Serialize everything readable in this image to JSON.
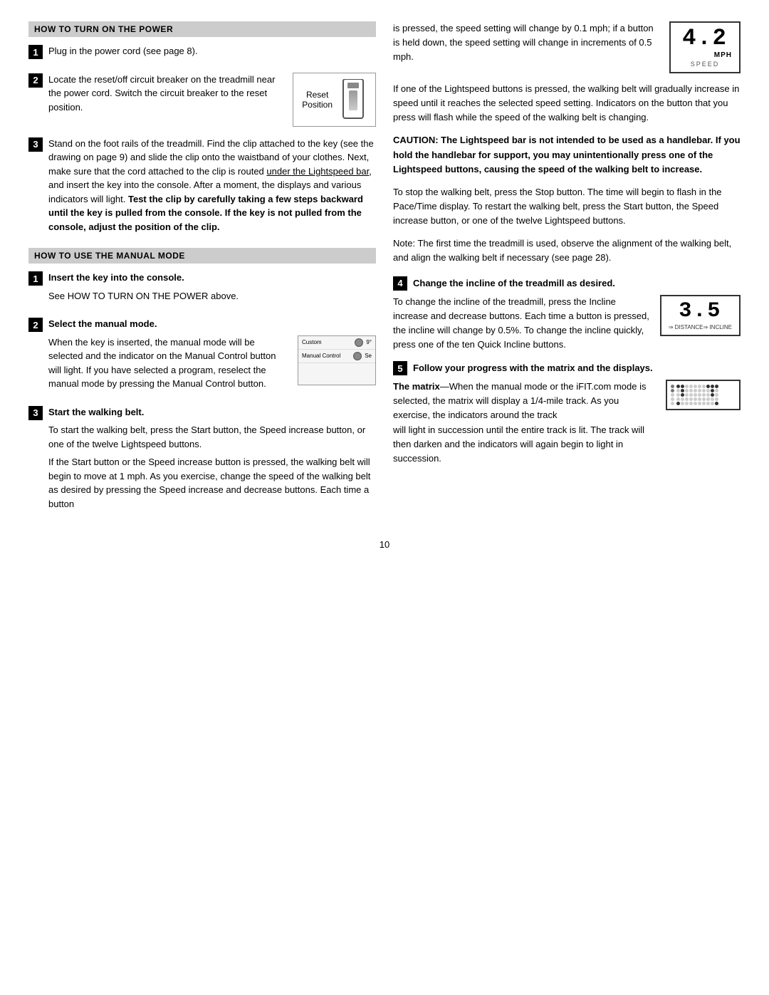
{
  "left_col": {
    "section1": {
      "header": "HOW TO TURN ON THE POWER",
      "step1": {
        "number": "1",
        "text": "Plug in the power cord (see page 8)."
      },
      "step2": {
        "number": "2",
        "text_before": "Locate the reset/off circuit breaker on the treadmill near the power cord. Switch the circuit breaker to the reset position.",
        "reset_label_line1": "Reset",
        "reset_label_line2": "Position"
      },
      "step3": {
        "number": "3",
        "text": "Stand on the foot rails of the treadmill. Find the clip attached to the key (see the drawing on page 9) and slide the clip onto the waistband of your clothes. Next, make sure that the cord attached to the clip is routed ",
        "underline": "under the Lightspeed bar,",
        "text2": " and insert the key into the console. After a moment, the displays and various indicators will light. ",
        "bold_part": "Test the clip by carefully taking a few steps backward until the key is pulled from the console. If the key is not pulled from the console, adjust the position of the clip."
      }
    },
    "section2": {
      "header": "HOW TO USE THE MANUAL MODE",
      "step1": {
        "number": "1",
        "title": "Insert the key into the console.",
        "text": "See HOW TO TURN ON THE POWER above."
      },
      "step2": {
        "number": "2",
        "title": "Select the manual mode.",
        "text1": "When the key is inserted, the manual mode will be selected and the indicator on the Manual Control button will light. If you have selected a program, reselect the manual mode by pressing the Manual Control button.",
        "btn1": "Custom",
        "btn2": "Manual Control"
      },
      "step3": {
        "number": "3",
        "title": "Start the walking belt.",
        "text1": "To start the walking belt, press the Start button, the Speed increase button, or one of the twelve Lightspeed buttons.",
        "text2": "If the Start button or the Speed increase button is pressed, the walking belt will begin to move at 1 mph. As you exercise, change the speed of the walking belt as desired by pressing the Speed increase and decrease buttons. Each time a button"
      }
    }
  },
  "right_col": {
    "speed_display": {
      "number": "4.2",
      "unit": "MPH",
      "label": "SPEED"
    },
    "para1": "is pressed, the speed setting will change by 0.1 mph; if a button is held down, the speed setting will change in increments of 0.5 mph.",
    "para2": "If one of the Lightspeed buttons is pressed, the walking belt will gradually increase in speed until it reaches the selected speed setting. Indicators on the button that you press will flash while the speed of the walking belt is changing.",
    "caution": {
      "text": "CAUTION: The Lightspeed bar is not intended to be used as a handlebar. If you hold the handlebar for support, you may unintentionally press one of the Lightspeed buttons, causing the speed of the walking belt to increase."
    },
    "para3": "To stop the walking belt, press the Stop button. The time will begin to flash in the Pace/Time display. To restart the walking belt, press the Start button, the Speed increase button, or one of the twelve Lightspeed buttons.",
    "para4": "Note: The first time the treadmill is used, observe the alignment of the walking belt, and align the walking belt if necessary (see page 28).",
    "step4": {
      "number": "4",
      "title": "Change the incline of the treadmill as desired.",
      "text1": "To change the incline of the treadmill, press the Incline increase and decrease buttons. Each time a button is pressed, the incline will change by 0.5%. To change the incline quickly, press one of the ten Quick Incline buttons.",
      "incline_number": "3.5",
      "label_distance": "DISTANCE",
      "label_incline": "INCLINE"
    },
    "step5": {
      "number": "5",
      "title": "Follow your progress with the matrix and the displays.",
      "matrix_label": "The matrix",
      "matrix_text": "—When the manual mode or the iFIT.com mode is selected, the matrix will display a 1/4-mile track. As you exercise, the indicators around the track",
      "text2": "will light in succession until the entire track is lit. The track will then darken and the indicators will again begin to light in succession."
    }
  },
  "page_number": "10"
}
